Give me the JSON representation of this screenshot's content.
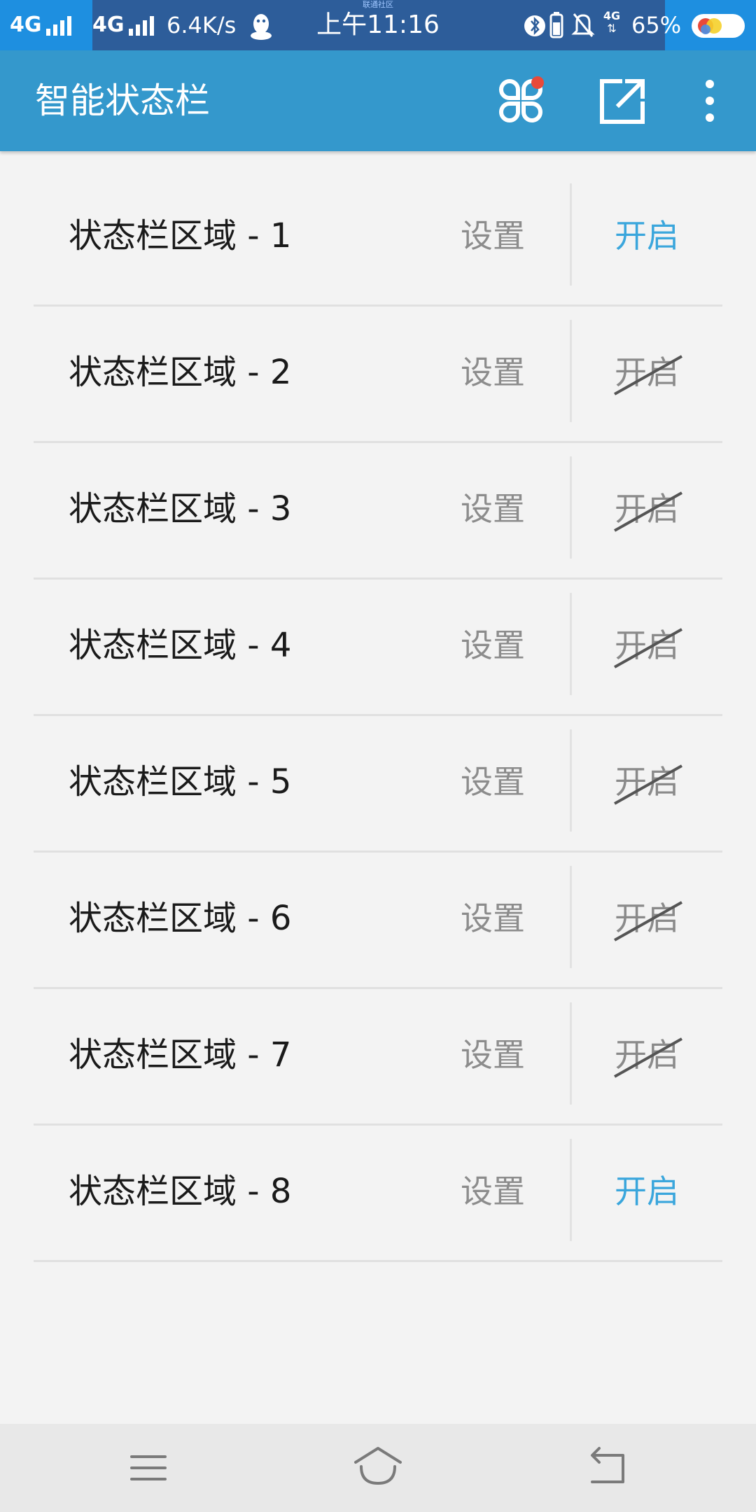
{
  "status_bar": {
    "signal_1": "4G",
    "signal_2": "4G",
    "net_speed": "6.4K/s",
    "carrier_tiny": "联通社区",
    "time": "上午11:16",
    "network_small": "4G",
    "battery": "65%",
    "icons": [
      "signal-icon",
      "qq-icon",
      "bluetooth-icon",
      "battery-saver-icon",
      "mute-icon",
      "data-arrows-icon",
      "toggle-icon"
    ]
  },
  "app_bar": {
    "title": "智能状态栏",
    "actions": [
      {
        "name": "apps-icon",
        "badge_color": "#e8493a"
      },
      {
        "name": "share-external-icon"
      },
      {
        "name": "more-vert-icon"
      }
    ]
  },
  "list": {
    "settings_label": "设置",
    "items": [
      {
        "label": "状态栏区域 - 1",
        "settings": "设置",
        "toggle": "开启",
        "enabled": true
      },
      {
        "label": "状态栏区域 - 2",
        "settings": "设置",
        "toggle": "开启",
        "enabled": false
      },
      {
        "label": "状态栏区域 - 3",
        "settings": "设置",
        "toggle": "开启",
        "enabled": false
      },
      {
        "label": "状态栏区域 - 4",
        "settings": "设置",
        "toggle": "开启",
        "enabled": false
      },
      {
        "label": "状态栏区域 - 5",
        "settings": "设置",
        "toggle": "开启",
        "enabled": false
      },
      {
        "label": "状态栏区域 - 6",
        "settings": "设置",
        "toggle": "开启",
        "enabled": false
      },
      {
        "label": "状态栏区域 - 7",
        "settings": "设置",
        "toggle": "开启",
        "enabled": false
      },
      {
        "label": "状态栏区域 - 8",
        "settings": "设置",
        "toggle": "开启",
        "enabled": true
      }
    ]
  },
  "nav_bar": {
    "buttons": [
      "menu-icon",
      "home-icon",
      "back-icon"
    ]
  },
  "colors": {
    "status_bar": "#2d5d9a",
    "status_highlight": "#1e8fe0",
    "app_bar": "#3498cc",
    "accent_on": "#3aa6dc",
    "off": "#8a8a8a",
    "background": "#f3f3f3"
  }
}
